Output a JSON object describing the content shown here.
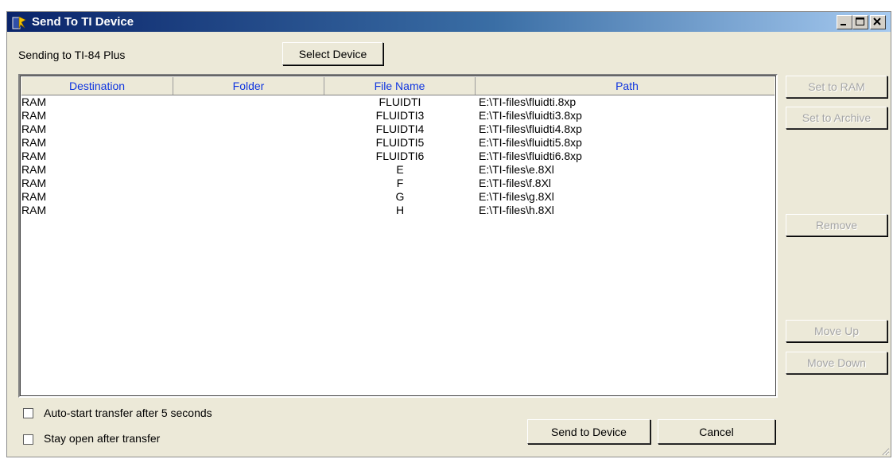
{
  "window": {
    "title": "Send To TI Device",
    "icon": "ti-connect-icon",
    "controls": [
      "minimize-icon",
      "maximize-icon",
      "close-icon"
    ]
  },
  "sending_label": "Sending to TI-84 Plus",
  "select_device_label": "Select Device",
  "columns": [
    "Destination",
    "Folder",
    "File Name",
    "Path"
  ],
  "rows": [
    {
      "destination": "RAM",
      "folder": "",
      "file_name": "FLUIDTI",
      "path": "E:\\TI-files\\fluidti.8xp"
    },
    {
      "destination": "RAM",
      "folder": "",
      "file_name": "FLUIDTI3",
      "path": "E:\\TI-files\\fluidti3.8xp"
    },
    {
      "destination": "RAM",
      "folder": "",
      "file_name": "FLUIDTI4",
      "path": "E:\\TI-files\\fluidti4.8xp"
    },
    {
      "destination": "RAM",
      "folder": "",
      "file_name": "FLUIDTI5",
      "path": "E:\\TI-files\\fluidti5.8xp"
    },
    {
      "destination": "RAM",
      "folder": "",
      "file_name": "FLUIDTI6",
      "path": "E:\\TI-files\\fluidti6.8xp"
    },
    {
      "destination": "RAM",
      "folder": "",
      "file_name": "E",
      "path": "E:\\TI-files\\e.8Xl"
    },
    {
      "destination": "RAM",
      "folder": "",
      "file_name": "F",
      "path": "E:\\TI-files\\f.8Xl"
    },
    {
      "destination": "RAM",
      "folder": "",
      "file_name": "G",
      "path": "E:\\TI-files\\g.8Xl"
    },
    {
      "destination": "RAM",
      "folder": "",
      "file_name": "H",
      "path": "E:\\TI-files\\h.8Xl"
    }
  ],
  "side_buttons": {
    "set_ram": "Set to RAM",
    "set_archive": "Set to Archive",
    "remove": "Remove",
    "move_up": "Move Up",
    "move_down": "Move Down"
  },
  "checkboxes": {
    "auto_start": {
      "label": "Auto-start transfer after 5 seconds",
      "checked": false
    },
    "stay_open": {
      "label": "Stay open after transfer",
      "checked": false
    }
  },
  "bottom_buttons": {
    "send": "Send to Device",
    "cancel": "Cancel"
  },
  "colors": {
    "title_bar_start": "#0a246a",
    "title_bar_end": "#a6caf0",
    "header_text": "#0f35e0",
    "face": "#ece9d8",
    "disabled_text": "#a6a6a6"
  }
}
